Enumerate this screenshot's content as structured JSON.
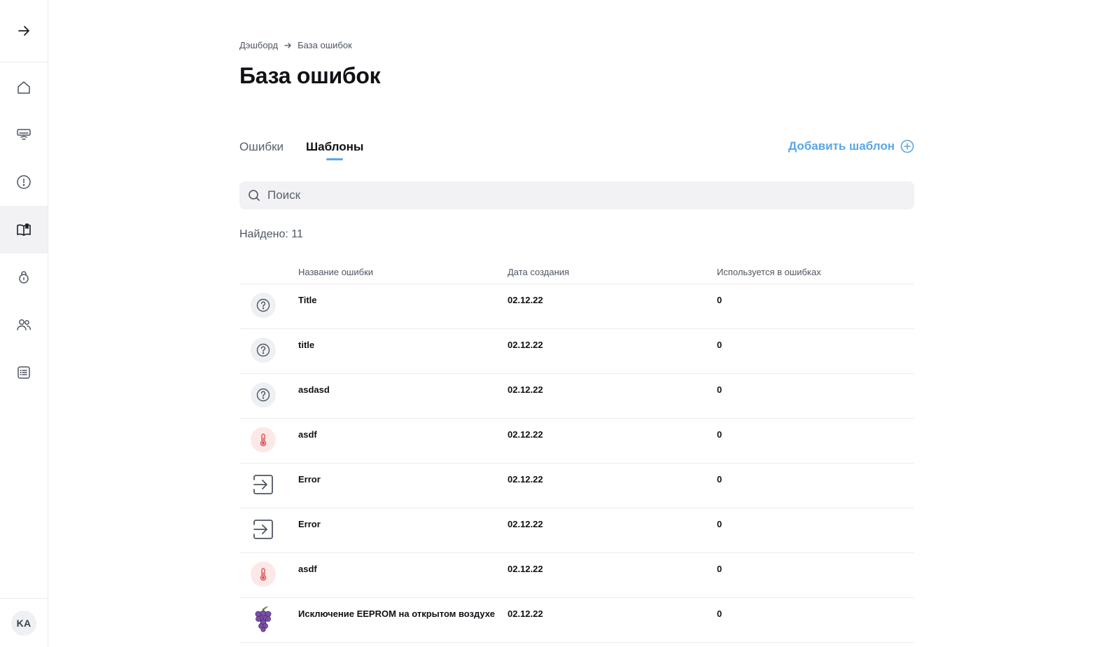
{
  "sidebar": {
    "toggle_icon": "arrow-right-icon",
    "items": [
      {
        "icon": "home-icon",
        "active": false
      },
      {
        "icon": "air-conditioner-icon",
        "active": false
      },
      {
        "icon": "alert-circle-icon",
        "active": false
      },
      {
        "icon": "book-icon",
        "active": true
      },
      {
        "icon": "lock-icon",
        "active": false
      },
      {
        "icon": "users-icon",
        "active": false
      },
      {
        "icon": "list-icon",
        "active": false
      }
    ],
    "avatar_initials": "KA"
  },
  "breadcrumb": {
    "parent": "Дэшборд",
    "current": "База ошибок"
  },
  "page_title": "База ошибок",
  "tabs": [
    {
      "label": "Ошибки",
      "active": false
    },
    {
      "label": "Шаблоны",
      "active": true
    }
  ],
  "add_button": {
    "label": "Добавить шаблон",
    "icon": "plus-circle-icon"
  },
  "search": {
    "placeholder": "Поиск",
    "value": ""
  },
  "found_text": "Найдено: 11",
  "table": {
    "columns": [
      "Название ошибки",
      "Дата создания",
      "Используется в ошибках"
    ],
    "rows": [
      {
        "icon": "question-icon",
        "name": "Title",
        "date": "02.12.22",
        "used": "0"
      },
      {
        "icon": "question-icon",
        "name": "title",
        "date": "02.12.22",
        "used": "0"
      },
      {
        "icon": "question-icon",
        "name": "asdasd",
        "date": "02.12.22",
        "used": "0"
      },
      {
        "icon": "thermometer-icon",
        "name": "asdf",
        "date": "02.12.22",
        "used": "0"
      },
      {
        "icon": "login-arrow-icon",
        "name": "Error",
        "date": "02.12.22",
        "used": "0"
      },
      {
        "icon": "login-arrow-icon",
        "name": "Error",
        "date": "02.12.22",
        "used": "0"
      },
      {
        "icon": "thermometer-icon",
        "name": "asdf",
        "date": "02.12.22",
        "used": "0"
      },
      {
        "icon": "grapes-icon",
        "name": "Исключение EEPROM на открытом воздухе",
        "date": "02.12.22",
        "used": "0"
      }
    ]
  },
  "colors": {
    "accent": "#5aa7e6",
    "active_nav_bg": "#f2f2f5",
    "thermometer": "#e05252",
    "grapes": "#7b4fa8"
  }
}
